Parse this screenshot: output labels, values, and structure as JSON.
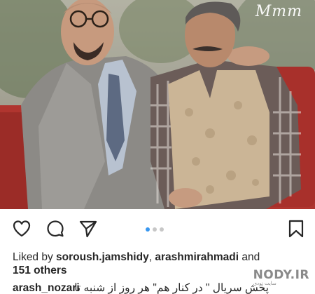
{
  "post": {
    "photo_watermark": "Mmm",
    "carousel": {
      "pages": 3,
      "current": 1
    },
    "likes": {
      "prefix": "Liked by ",
      "user1": "soroush.jamshidy",
      "separator": ", ",
      "user2": "arashmirahmadi",
      "and_text": " and",
      "others": "151 others"
    },
    "caption": {
      "username": "arash_nozari",
      "text": "پخش سریال \" در کنار هم\" هر روز از شنبه تا"
    }
  },
  "site_watermark": {
    "name": "NODY.IR",
    "tagline": "سایت نودی"
  },
  "icons": [
    "heart-icon",
    "comment-icon",
    "share-icon",
    "bookmark-icon"
  ]
}
